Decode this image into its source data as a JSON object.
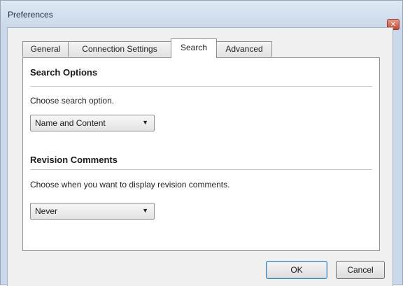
{
  "window": {
    "title": "Preferences",
    "close_glyph": "✕"
  },
  "tabs": [
    {
      "label": "General"
    },
    {
      "label": "Connection Settings"
    },
    {
      "label": "Search",
      "active": true
    },
    {
      "label": "Advanced"
    }
  ],
  "search_options": {
    "heading": "Search Options",
    "description": "Choose search option.",
    "selected": "Name and Content"
  },
  "revision_comments": {
    "heading": "Revision Comments",
    "description": "Choose when you want to display revision comments.",
    "selected": "Never"
  },
  "buttons": {
    "ok": "OK",
    "cancel": "Cancel"
  },
  "icons": {
    "close": "close-icon",
    "dropdown": "chevron-down-icon"
  },
  "colors": {
    "title_bar": "#c9d8ea",
    "close_button": "#c4472f",
    "default_button_border": "#3c7fb1"
  }
}
